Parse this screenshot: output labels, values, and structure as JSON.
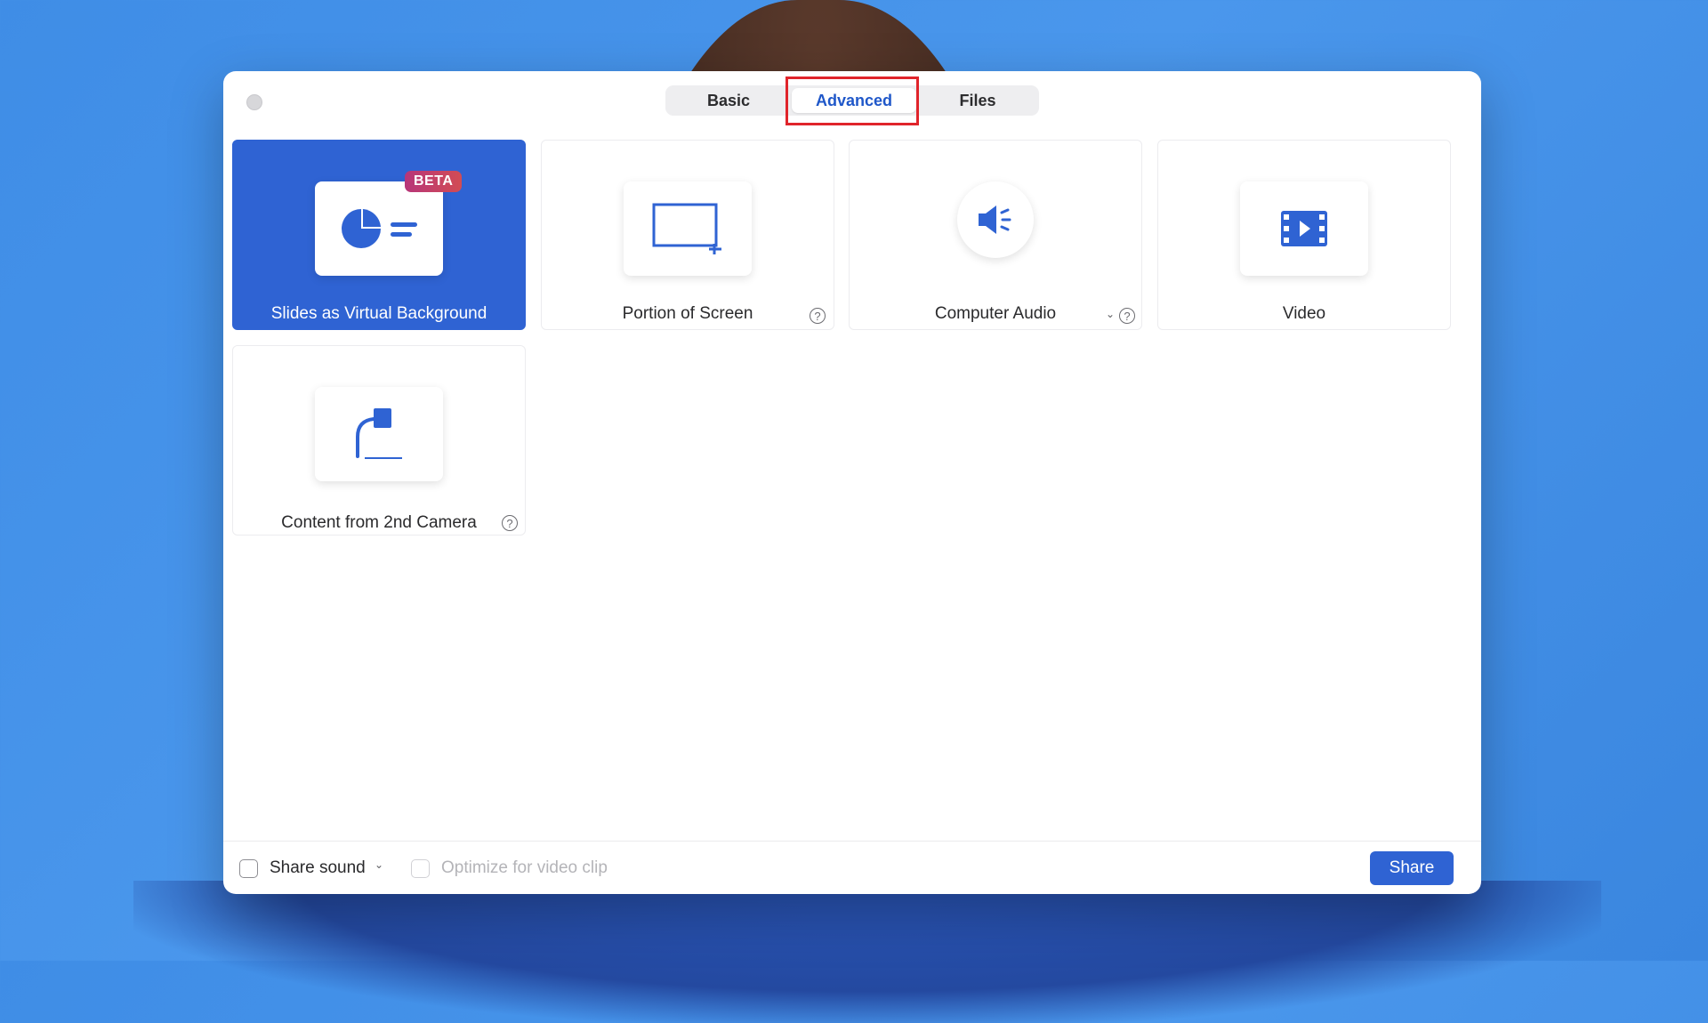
{
  "tabs": [
    {
      "label": "Basic",
      "active": false
    },
    {
      "label": "Advanced",
      "active": true
    },
    {
      "label": "Files",
      "active": false
    }
  ],
  "options": [
    {
      "label": "Slides as Virtual Background",
      "badge": "BETA",
      "selected": true,
      "icon": "slides-icon"
    },
    {
      "label": "Portion of Screen",
      "selected": false,
      "icon": "screen-portion-icon",
      "help": true
    },
    {
      "label": "Computer Audio",
      "selected": false,
      "icon": "speaker-icon",
      "dropdown": true,
      "help": true
    },
    {
      "label": "Video",
      "selected": false,
      "icon": "film-icon"
    },
    {
      "label": "Content from 2nd Camera",
      "selected": false,
      "icon": "document-camera-icon",
      "help": true
    }
  ],
  "footer": {
    "share_sound_label": "Share sound",
    "optimize_label": "Optimize for video clip",
    "share_button": "Share"
  },
  "colors": {
    "accent": "#2f63d3",
    "highlight": "#e0242b",
    "background": "#3f8de6"
  }
}
